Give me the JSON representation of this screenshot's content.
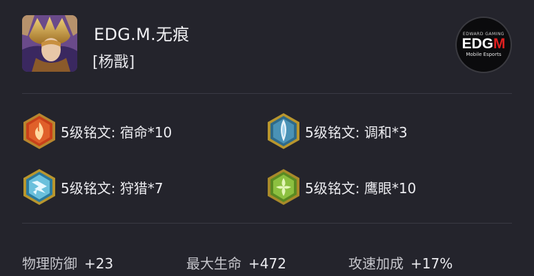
{
  "player": {
    "name": "EDG.M.无痕",
    "hero": "[杨戬]"
  },
  "team_logo": {
    "top_text": "EDWARD GAMING",
    "main_left": "EDG",
    "main_right": "M",
    "sub_text": "Mobile Esports"
  },
  "runes": [
    {
      "label": "5级铭文:  宿命*10",
      "icon": "red-fire-rune-icon",
      "color": "#d24a1c"
    },
    {
      "label": "5级铭文:  调和*3",
      "icon": "blue-crystal-rune-icon",
      "color": "#4a8fb8"
    },
    {
      "label": "5级铭文:  狩猎*7",
      "icon": "blue-lightning-rune-icon",
      "color": "#3aa0c8"
    },
    {
      "label": "5级铭文:  鹰眼*10",
      "icon": "green-leaf-rune-icon",
      "color": "#6a9a2a"
    }
  ],
  "stats": [
    {
      "key": "物理防御",
      "value": "+23"
    },
    {
      "key": "最大生命",
      "value": "+472"
    },
    {
      "key": "攻速加成",
      "value": "+17%"
    }
  ]
}
